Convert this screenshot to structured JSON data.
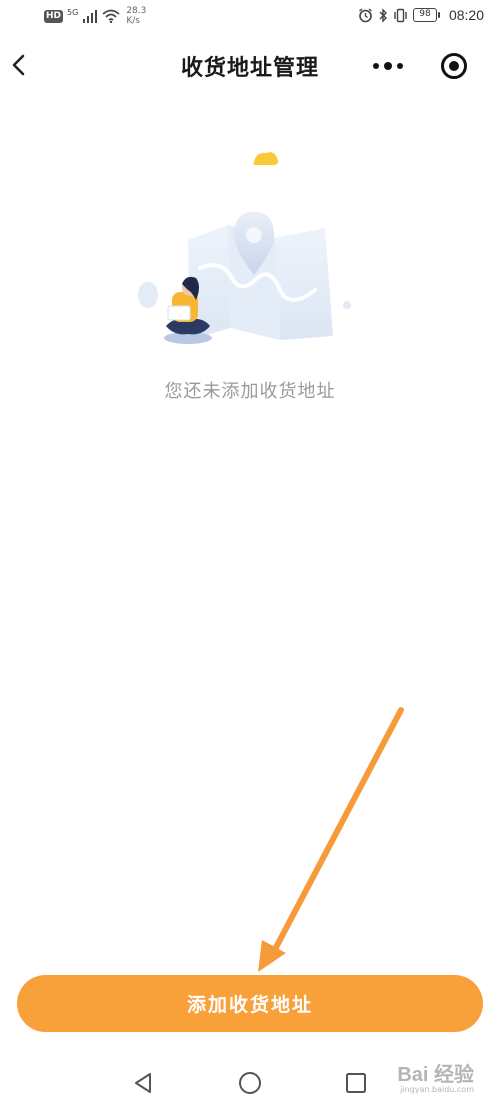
{
  "status_bar": {
    "hd": "HD",
    "network": "5G",
    "speed_value": "28.3",
    "speed_unit": "K/s",
    "battery": "98",
    "time": "08:20"
  },
  "header": {
    "title": "收货地址管理"
  },
  "empty_state": {
    "message": "您还未添加收货地址"
  },
  "add_button": {
    "label": "添加收货地址"
  },
  "watermark": {
    "main": "Bai 经验",
    "sub": "jingyan.baidu.com"
  },
  "colors": {
    "accent": "#f8a03a",
    "arrow": "#f79a3a",
    "empty_text": "#9a9a9a"
  },
  "icons": {
    "back": "chevron-left-icon",
    "more": "more-dots-icon",
    "close": "target-circle-icon",
    "nav_back": "triangle-back-icon",
    "nav_home": "circle-home-icon",
    "nav_recent": "square-recent-icon"
  }
}
